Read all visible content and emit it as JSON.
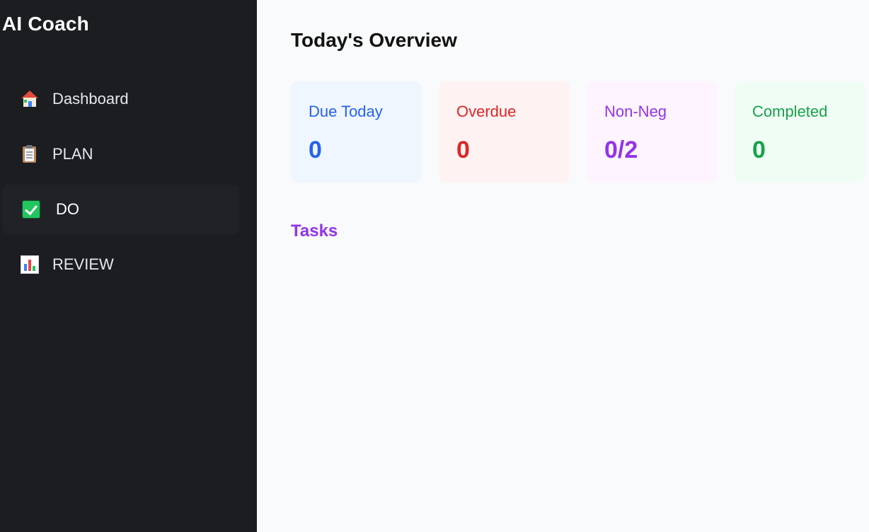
{
  "sidebar": {
    "app_title": "AI Coach",
    "items": [
      {
        "label": "Dashboard",
        "icon": "house-icon",
        "active": false
      },
      {
        "label": "PLAN",
        "icon": "clipboard-icon",
        "active": false
      },
      {
        "label": "DO",
        "icon": "check-mark-icon",
        "active": true
      },
      {
        "label": "REVIEW",
        "icon": "bar-chart-icon",
        "active": false
      }
    ]
  },
  "main": {
    "overview_title": "Today's Overview",
    "cards": [
      {
        "label": "Due Today",
        "value": "0",
        "text_color": "#2563eb",
        "bg_color": "#eff6ff"
      },
      {
        "label": "Overdue",
        "value": "0",
        "text_color": "#dc2626",
        "bg_color": "#fef2f2"
      },
      {
        "label": "Non-Neg",
        "value": "0/2",
        "text_color": "#9333ea",
        "bg_color": "#fdf4ff"
      },
      {
        "label": "Completed",
        "value": "0",
        "text_color": "#16a34a",
        "bg_color": "#f0fdf4"
      }
    ],
    "tasks_heading": "Tasks"
  },
  "colors": {
    "sidebar_bg": "#1b1d21",
    "active_item_bg": "#202227",
    "main_bg": "#f9fafb",
    "accent_purple": "#9333ea"
  }
}
